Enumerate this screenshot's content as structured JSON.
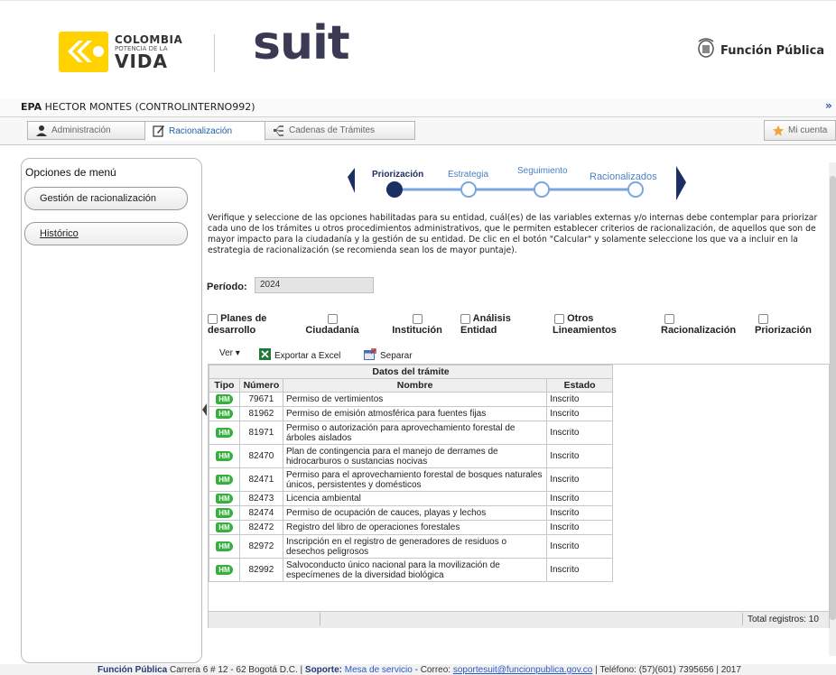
{
  "header": {
    "colombia_line1": "COLOMBIA",
    "colombia_line2": "POTENCIA DE LA",
    "colombia_line3": "VIDA",
    "suit": "suit",
    "funcion_publica": "Función Pública"
  },
  "user_bar": {
    "org": "EPA",
    "user": "HECTOR MONTES (CONTROLINTERNO992)",
    "expand": "»"
  },
  "tabs": [
    {
      "label": "Administración",
      "icon": "user-icon",
      "active": false
    },
    {
      "label": "Racionalización",
      "icon": "edit-icon",
      "active": true
    },
    {
      "label": "Cadenas de Trámites",
      "icon": "chain-icon",
      "active": false
    }
  ],
  "account_button": "Mi cuenta",
  "sidebar": {
    "title": "Opciones de menú",
    "items": [
      {
        "label": "Gestión de racionalización"
      },
      {
        "label": "Histórico"
      }
    ]
  },
  "stepper": {
    "steps": [
      "Priorización",
      "Estrategia",
      "Seguimiento",
      "Racionalizados"
    ],
    "active_index": 0
  },
  "description": "Verifique y seleccione de las opciones habilitadas para su entidad, cuál(es) de las variables externas y/o internas debe contemplar para priorizar cada uno de los trámites u otros procedimientos administrativos, que le permiten establecer criterios de racionalización, de aquellos que son de mayor impacto para la ciudadanía y la gestión de su entidad. De clic en el botón \"Calcular\" y solamente seleccione los que va a incluir en la estrategia de racionalización (se recomienda sean los de mayor puntaje).",
  "period": {
    "label": "Período:",
    "value": "2024"
  },
  "criteria": [
    {
      "line1": "Planes de",
      "line2": "desarrollo"
    },
    {
      "line1": "",
      "line2": "Ciudadanía"
    },
    {
      "line1": "",
      "line2": "Institución"
    },
    {
      "line1": "Análisis",
      "line2": "Entidad"
    },
    {
      "line1": "Otros",
      "line2": "Lineamientos"
    },
    {
      "line1": "",
      "line2": "Racionalización"
    },
    {
      "line1": "",
      "line2": "Priorización"
    }
  ],
  "toolbar": {
    "view": "Ver ▾",
    "export": "Exportar a Excel",
    "separate": "Separar"
  },
  "grid": {
    "group_header": "Datos del trámite",
    "columns": [
      "Tipo",
      "Número",
      "Nombre",
      "Estado"
    ],
    "badge": "HM",
    "rows": [
      {
        "numero": "79671",
        "nombre": "Permiso de vertimientos",
        "estado": "Inscrito"
      },
      {
        "numero": "81962",
        "nombre": "Permiso de emisión atmosférica para fuentes fijas",
        "estado": "Inscrito"
      },
      {
        "numero": "81971",
        "nombre": "Permiso o autorización para aprovechamiento forestal de árboles aislados",
        "estado": "Inscrito"
      },
      {
        "numero": "82470",
        "nombre": "Plan de contingencia para el manejo de derrames de hidrocarburos o sustancias nocivas",
        "estado": "Inscrito"
      },
      {
        "numero": "82471",
        "nombre": "Permiso para el aprovechamiento forestal de bosques naturales únicos, persistentes y domésticos",
        "estado": "Inscrito"
      },
      {
        "numero": "82473",
        "nombre": "Licencia ambiental",
        "estado": "Inscrito"
      },
      {
        "numero": "82474",
        "nombre": "Permiso de ocupación de cauces, playas y lechos",
        "estado": "Inscrito"
      },
      {
        "numero": "82472",
        "nombre": "Registro del libro de operaciones forestales",
        "estado": "Inscrito"
      },
      {
        "numero": "82972",
        "nombre": "Inscripción en el registro de generadores de residuos o desechos peligrosos",
        "estado": "Inscrito"
      },
      {
        "numero": "82992",
        "nombre": "Salvoconducto único nacional para la movilización de especímenes de la diversidad biológica",
        "estado": "Inscrito"
      }
    ],
    "total": "Total registros: 10"
  },
  "footer": {
    "org": "Función Pública",
    "address": " Carrera 6 # 12 - 62 Bogotá D.C. | ",
    "support_label": "Soporte:",
    "support_link": " Mesa de servicio",
    "mail_label": " - Correo: ",
    "mail": "soportesuit@funcionpublica.gov.co",
    "phone": " | Teléfono: (57)(601) 7395656 | 2017"
  },
  "colors": {
    "accent_blue": "#1e5fa5",
    "step_dark": "#1c2f63",
    "step_line": "#7aa6de",
    "badge_green": "#35b03c",
    "yellow": "#ffd200"
  }
}
